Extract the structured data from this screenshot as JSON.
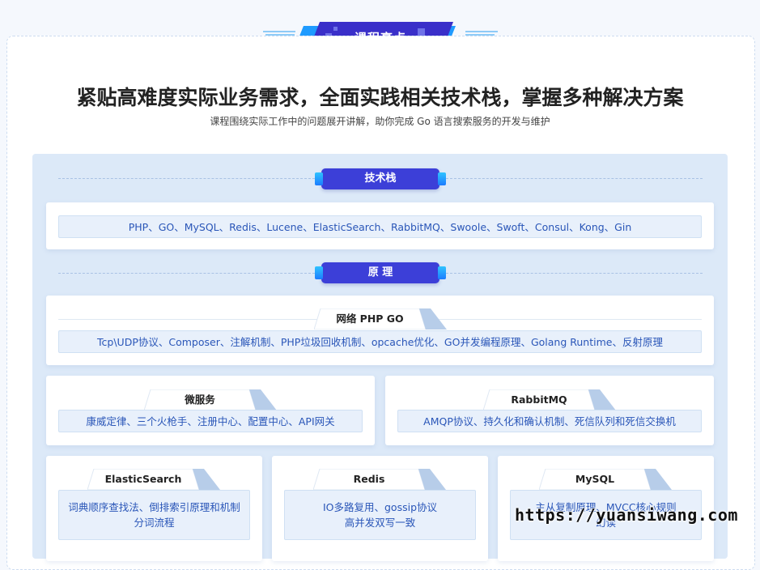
{
  "header": {
    "ribbon_title": "课程亮点",
    "headline": "紧贴高难度实际业务需求，全面实践相关技术栈，掌握多种解决方案",
    "subheadline": "课程围绕实际工作中的问题展开讲解，助你完成 Go 语言搜索服务的开发与维护"
  },
  "sections": {
    "tech_stack": {
      "label": "技术栈",
      "items": "PHP、GO、MySQL、Redis、Lucene、ElasticSearch、RabbitMQ、Swoole、Swoft、Consul、Kong、Gin"
    },
    "principles": {
      "label": "原 理"
    }
  },
  "cards": {
    "network": {
      "title": "网络 PHP GO",
      "content": "Tcp\\UDP协议、Composer、注解机制、PHP垃圾回收机制、opcache优化、GO并发编程原理、Golang Runtime、反射原理"
    },
    "microservice": {
      "title": "微服务",
      "content": "康威定律、三个火枪手、注册中心、配置中心、API网关"
    },
    "rabbitmq": {
      "title": "RabbitMQ",
      "content": "AMQP协议、持久化和确认机制、死信队列和死信交换机"
    },
    "elasticsearch": {
      "title": "ElasticSearch",
      "line1": "词典顺序查找法、倒排索引原理和机制",
      "line2": "分词流程"
    },
    "redis": {
      "title": "Redis",
      "line1": "IO多路复用、gossip协议",
      "line2": "高并发双写一致"
    },
    "mysql": {
      "title": "MySQL",
      "line1": "主从复制原理、MVCC核心规则",
      "line2": "幻读"
    }
  },
  "watermark": "https://yuansiwang.com",
  "colors": {
    "accent": "#3c3fd8",
    "accent_cyan": "#22b4ff",
    "link_text": "#2a56b8",
    "panel_bg": "#dce9f8"
  }
}
